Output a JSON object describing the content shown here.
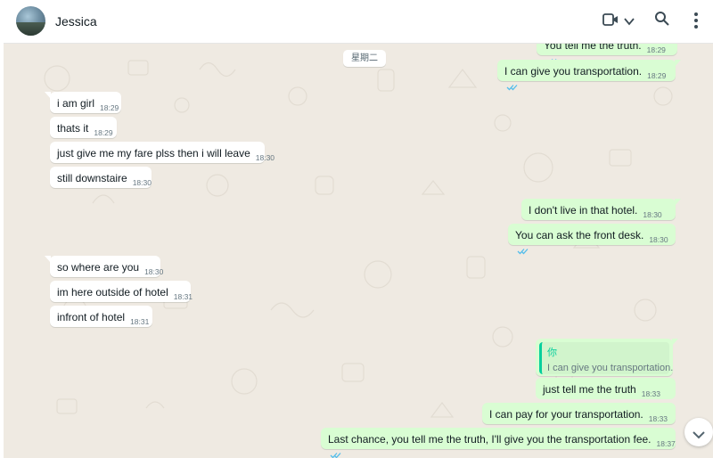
{
  "header": {
    "contact_name": "Jessica",
    "icons": [
      "video-call-icon",
      "chevron-down-icon",
      "search-icon",
      "menu-icon"
    ]
  },
  "chat": {
    "date_separator": "星期二",
    "messages": [
      {
        "dir": "out",
        "text": "You tell me the truth.",
        "time": "18:29",
        "read": true
      },
      {
        "dir": "out",
        "text": "I can give you transportation.",
        "time": "18:29",
        "read": true
      },
      {
        "dir": "in",
        "text": "i am girl",
        "time": "18:29"
      },
      {
        "dir": "in",
        "text": "thats it",
        "time": "18:29"
      },
      {
        "dir": "in",
        "text": "just give me my fare plss then i will leave",
        "time": "18:30"
      },
      {
        "dir": "in",
        "text": "still downstaire",
        "time": "18:30"
      },
      {
        "dir": "out",
        "text": "I don't live in that hotel.",
        "time": "18:30",
        "read": true
      },
      {
        "dir": "out",
        "text": "You can ask the front desk.",
        "time": "18:30",
        "read": true
      },
      {
        "dir": "in",
        "text": "so where are you",
        "time": "18:30"
      },
      {
        "dir": "in",
        "text": "im here outside of hotel",
        "time": "18:31"
      },
      {
        "dir": "in",
        "text": "infront of hotel",
        "time": "18:31"
      },
      {
        "dir": "out",
        "quote_author": "你",
        "quote_text": "I can give you transportation.",
        "text": "just tell me the truth",
        "time": "18:33",
        "read": true
      },
      {
        "dir": "out",
        "text": "I can pay for your transportation.",
        "time": "18:33",
        "read": true
      },
      {
        "dir": "out",
        "text": "Last chance, you tell me the truth, I'll give you the transportation fee.",
        "time": "18:37",
        "read": true
      }
    ]
  },
  "colors": {
    "outgoing_bubble": "#d9fdd3",
    "incoming_bubble": "#ffffff",
    "chat_background": "#efeae2",
    "read_ticks": "#53bdeb",
    "quote_accent": "#06cf9c"
  }
}
